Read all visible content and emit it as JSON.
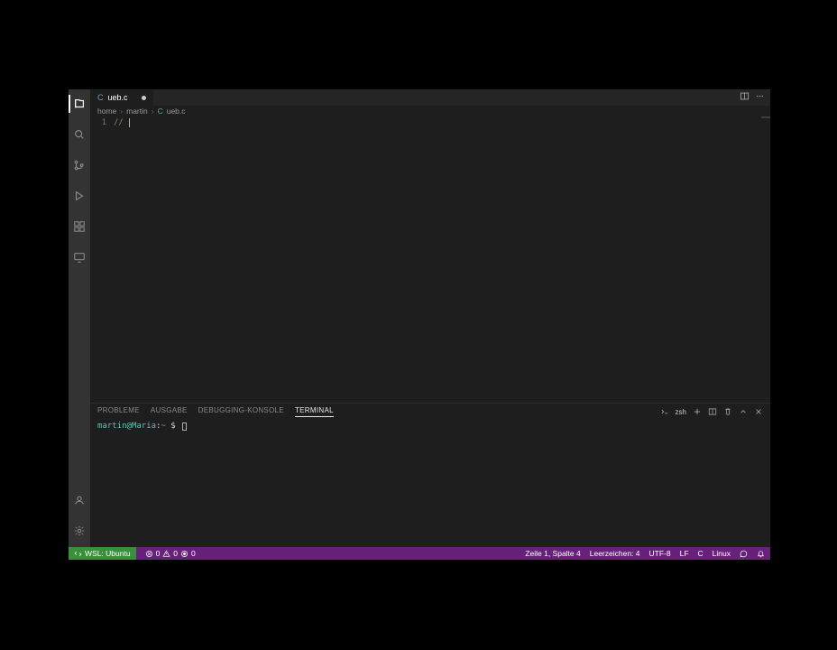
{
  "tab": {
    "lang_badge": "C",
    "filename": "ueb.c"
  },
  "breadcrumbs": {
    "seg0": "home",
    "seg1": "martin",
    "file_lang": "C",
    "file_name": "ueb.c"
  },
  "editor": {
    "line_number": "1",
    "content": "// "
  },
  "panel": {
    "tabs": {
      "probleme": "PROBLEME",
      "ausgabe": "AUSGABE",
      "debug": "DEBUGGING-KONSOLE",
      "terminal": "TERMINAL"
    },
    "shell_label": "zsh"
  },
  "terminal": {
    "user": "martin",
    "at": "@",
    "host": "Maria",
    "sep": ":",
    "path": "~",
    "prompt": " $ "
  },
  "statusbar": {
    "wsl": "WSL: Ubuntu",
    "errors": "0",
    "warnings": "0",
    "ports": "0",
    "line_col": "Zeile 1, Spalte 4",
    "spaces": "Leerzeichen: 4",
    "encoding": "UTF-8",
    "eol": "LF",
    "lang": "C",
    "os": "Linux"
  }
}
